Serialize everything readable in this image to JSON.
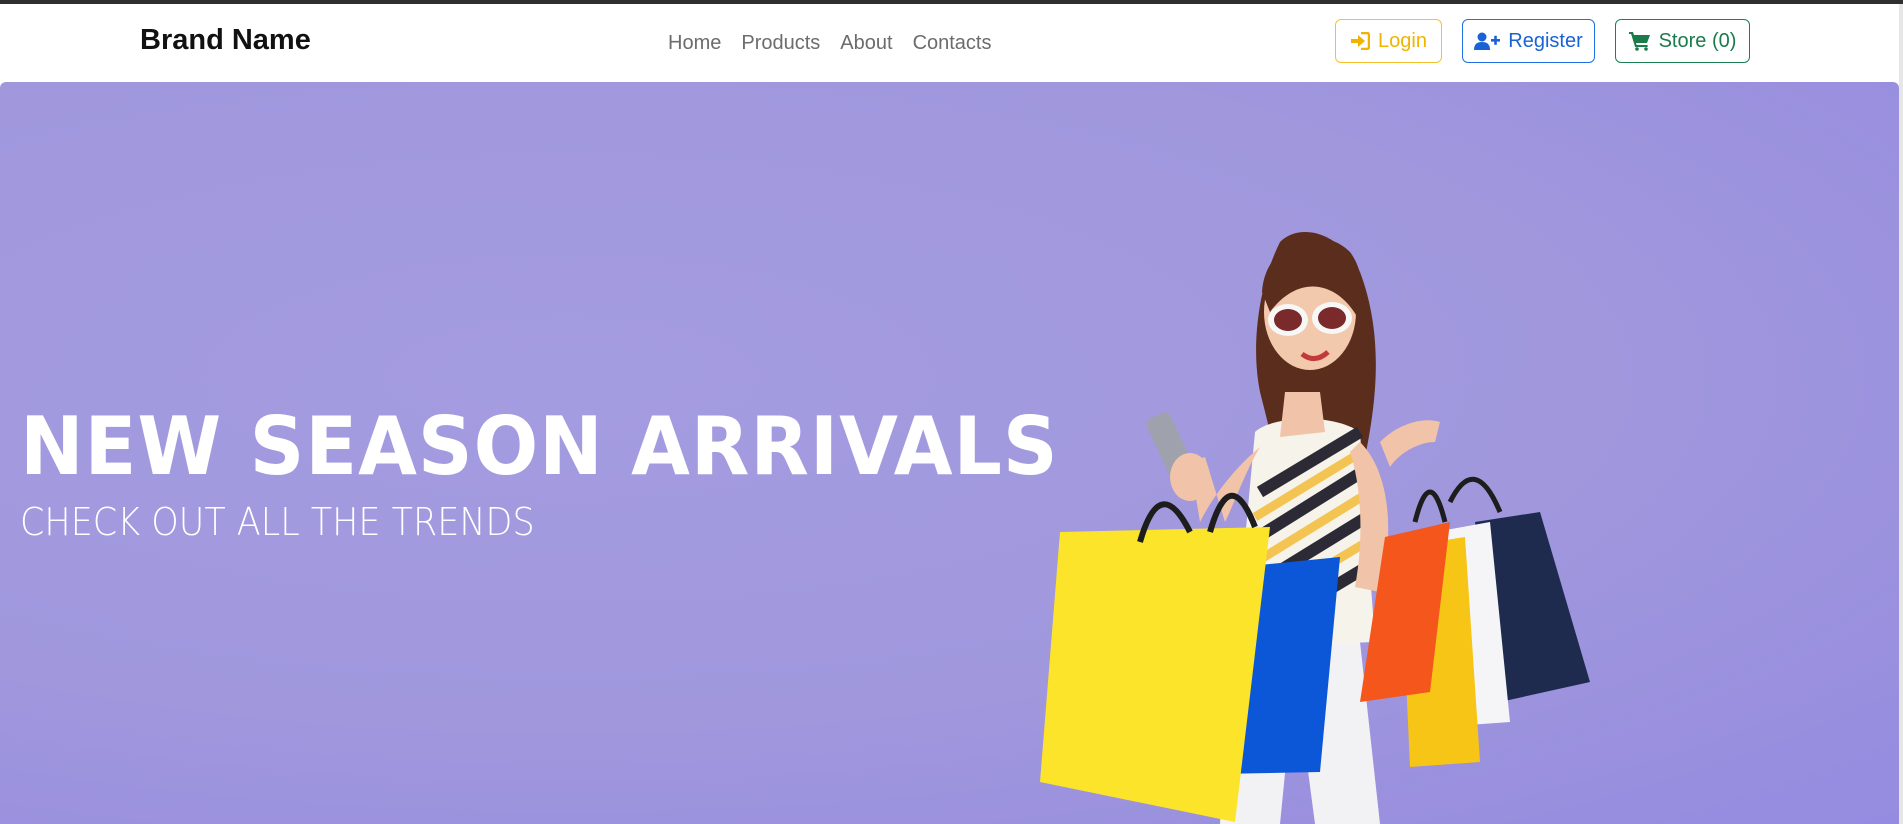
{
  "navbar": {
    "brand": "Brand Name",
    "links": [
      "Home",
      "Products",
      "About",
      "Contacts"
    ],
    "login_label": "Login",
    "register_label": "Register",
    "store_label": "Store (0)"
  },
  "hero": {
    "title": "NEW SEASON ARRIVALS",
    "subtitle": "CHECK OUT ALL THE TRENDS",
    "image_subject": "woman-with-shopping-bags"
  },
  "colors": {
    "hero_bg": "#a29ade",
    "login": "#f0b400",
    "register": "#1a63d6",
    "store": "#1b7b4a"
  },
  "icons": {
    "login": "sign-in-icon",
    "register": "user-plus-icon",
    "store": "cart-icon"
  }
}
